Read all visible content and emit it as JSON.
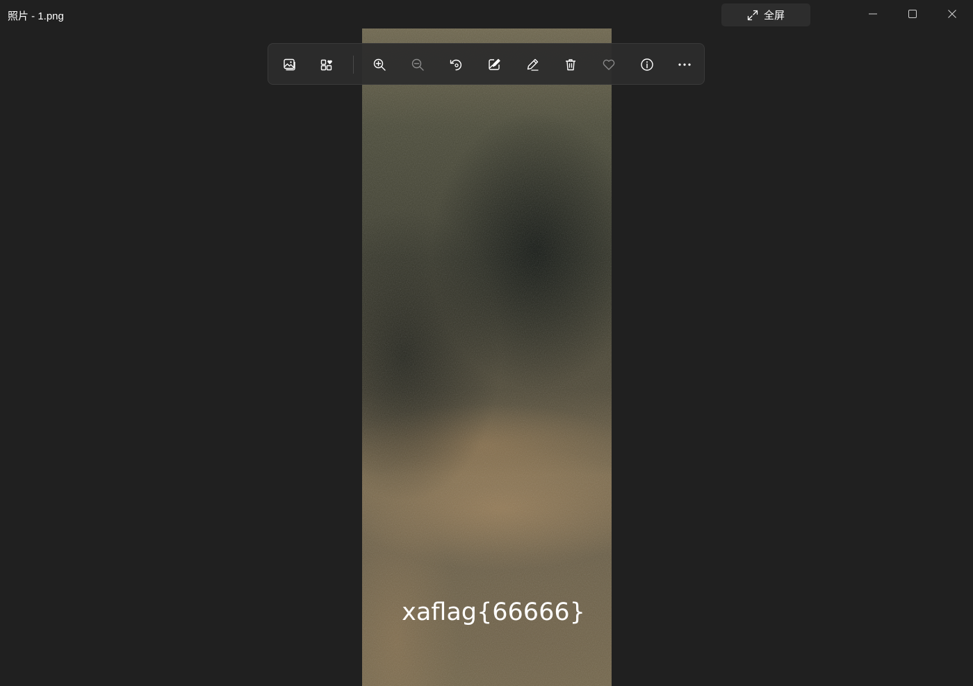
{
  "window": {
    "title": "照片 - 1.png",
    "fullscreen_label": "全屏"
  },
  "caption_buttons": [
    {
      "name": "minimize",
      "icon": "minimize-icon"
    },
    {
      "name": "maximize",
      "icon": "maximize-icon"
    },
    {
      "name": "close",
      "icon": "close-icon"
    }
  ],
  "toolbar": {
    "tools": [
      {
        "name": "view-image",
        "icon": "image-icon"
      },
      {
        "name": "add-to-favorites-album",
        "icon": "grid-heart-icon"
      },
      {
        "name": "zoom-in",
        "icon": "zoom-in-icon"
      },
      {
        "name": "zoom-out",
        "icon": "zoom-out-icon"
      },
      {
        "name": "rotate",
        "icon": "rotate-icon"
      },
      {
        "name": "edit-image",
        "icon": "edit-image-icon"
      },
      {
        "name": "draw",
        "icon": "pen-icon"
      },
      {
        "name": "delete",
        "icon": "trash-icon"
      },
      {
        "name": "favorite",
        "icon": "heart-icon"
      },
      {
        "name": "info",
        "icon": "info-icon"
      },
      {
        "name": "more",
        "icon": "more-icon"
      }
    ]
  },
  "photo": {
    "caption_text": "xaflag{66666}"
  },
  "colors": {
    "window_bg": "#202020",
    "toolbar_bg": "#2c2c2c",
    "button_bg": "#2d2d2d",
    "icon": "#ffffff",
    "icon_disabled": "#8a8a8a"
  }
}
